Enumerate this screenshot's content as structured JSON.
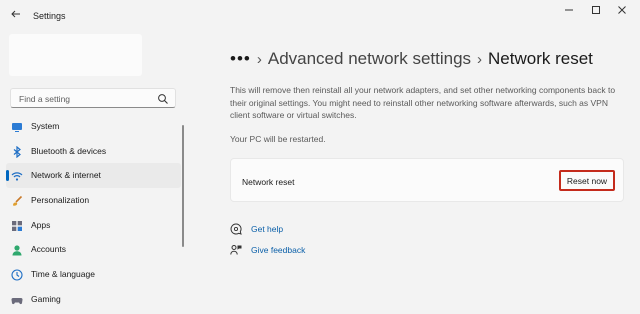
{
  "window": {
    "title": "Settings"
  },
  "search": {
    "placeholder": "Find a setting"
  },
  "sidebar": {
    "items": [
      {
        "label": "System",
        "icon": "monitor-icon"
      },
      {
        "label": "Bluetooth & devices",
        "icon": "bluetooth-icon"
      },
      {
        "label": "Network & internet",
        "icon": "wifi-icon",
        "active": true
      },
      {
        "label": "Personalization",
        "icon": "brush-icon"
      },
      {
        "label": "Apps",
        "icon": "apps-icon"
      },
      {
        "label": "Accounts",
        "icon": "person-icon"
      },
      {
        "label": "Time & language",
        "icon": "globe-clock-icon"
      },
      {
        "label": "Gaming",
        "icon": "gamepad-icon"
      }
    ]
  },
  "breadcrumb": {
    "overflow": "•••",
    "parent": "Advanced network settings",
    "current": "Network reset"
  },
  "main": {
    "description": "This will remove then reinstall all your network adapters, and set other networking components back to their original settings. You might need to reinstall other networking software afterwards, such as VPN client software or virtual switches.",
    "restart_note": "Your PC will be restarted.",
    "card": {
      "label": "Network reset",
      "button": "Reset now"
    },
    "links": {
      "help": "Get help",
      "feedback": "Give feedback"
    }
  },
  "colors": {
    "accent": "#0067c0",
    "highlight": "#c42b1c",
    "link": "#0a5fa8"
  }
}
